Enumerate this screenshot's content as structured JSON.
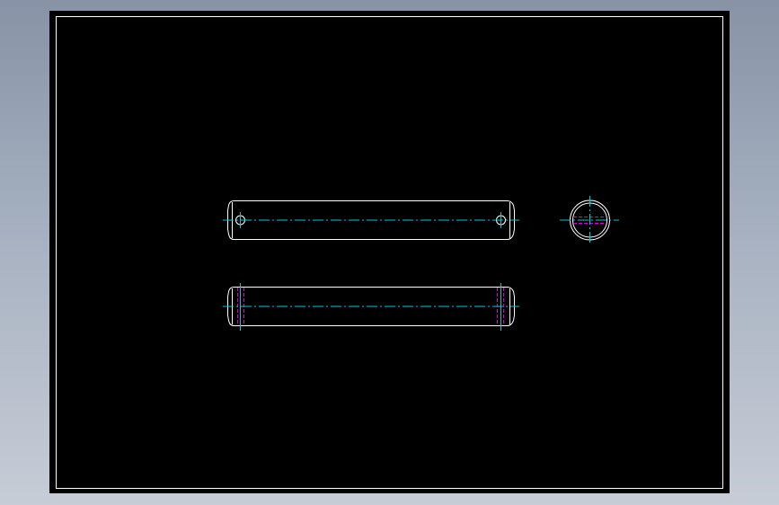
{
  "drawing": {
    "background_color": "#000000",
    "app_background_color": "#9aa4b4",
    "colors": {
      "outline": "#ffffff",
      "centerline": "#00c8d8",
      "hidden_line": "#d400d4"
    },
    "views": [
      "front-view",
      "top-view",
      "side-view"
    ]
  }
}
